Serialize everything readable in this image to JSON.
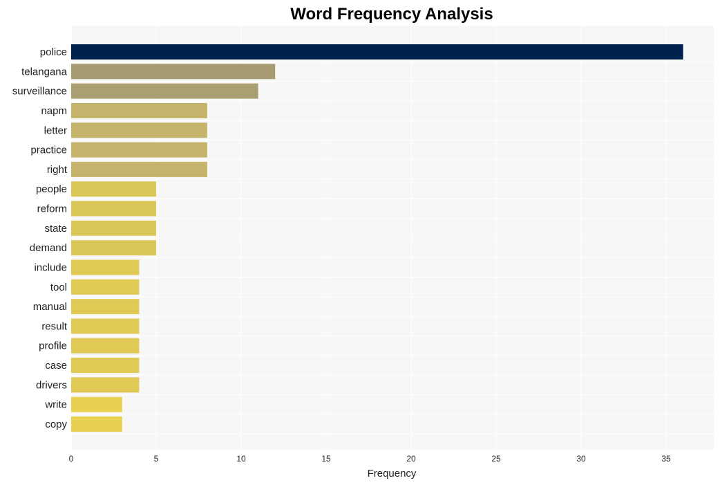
{
  "chart_data": {
    "type": "bar",
    "orientation": "horizontal",
    "title": "Word Frequency Analysis",
    "xlabel": "Frequency",
    "ylabel": "",
    "xlim": [
      0,
      38
    ],
    "xticks": [
      0,
      5,
      10,
      15,
      20,
      25,
      30,
      35
    ],
    "grid": true,
    "categories": [
      "police",
      "telangana",
      "surveillance",
      "napm",
      "letter",
      "practice",
      "right",
      "people",
      "reform",
      "state",
      "demand",
      "include",
      "tool",
      "manual",
      "result",
      "profile",
      "case",
      "drivers",
      "write",
      "copy"
    ],
    "values": [
      36,
      12,
      11,
      8,
      8,
      8,
      8,
      5,
      5,
      5,
      5,
      4,
      4,
      4,
      4,
      4,
      4,
      4,
      3,
      3
    ],
    "colors": [
      "#00224e",
      "#a59a72",
      "#aa9f73",
      "#c4b36a",
      "#c4b36a",
      "#c4b36a",
      "#c4b36a",
      "#dbc65a",
      "#dbc65a",
      "#dbc65a",
      "#dbc65a",
      "#e0ca55",
      "#e0ca55",
      "#e0ca55",
      "#e0ca55",
      "#e0ca55",
      "#e0ca55",
      "#e0ca55",
      "#e8d150",
      "#e8d150"
    ],
    "background": "#f7f7f7"
  }
}
